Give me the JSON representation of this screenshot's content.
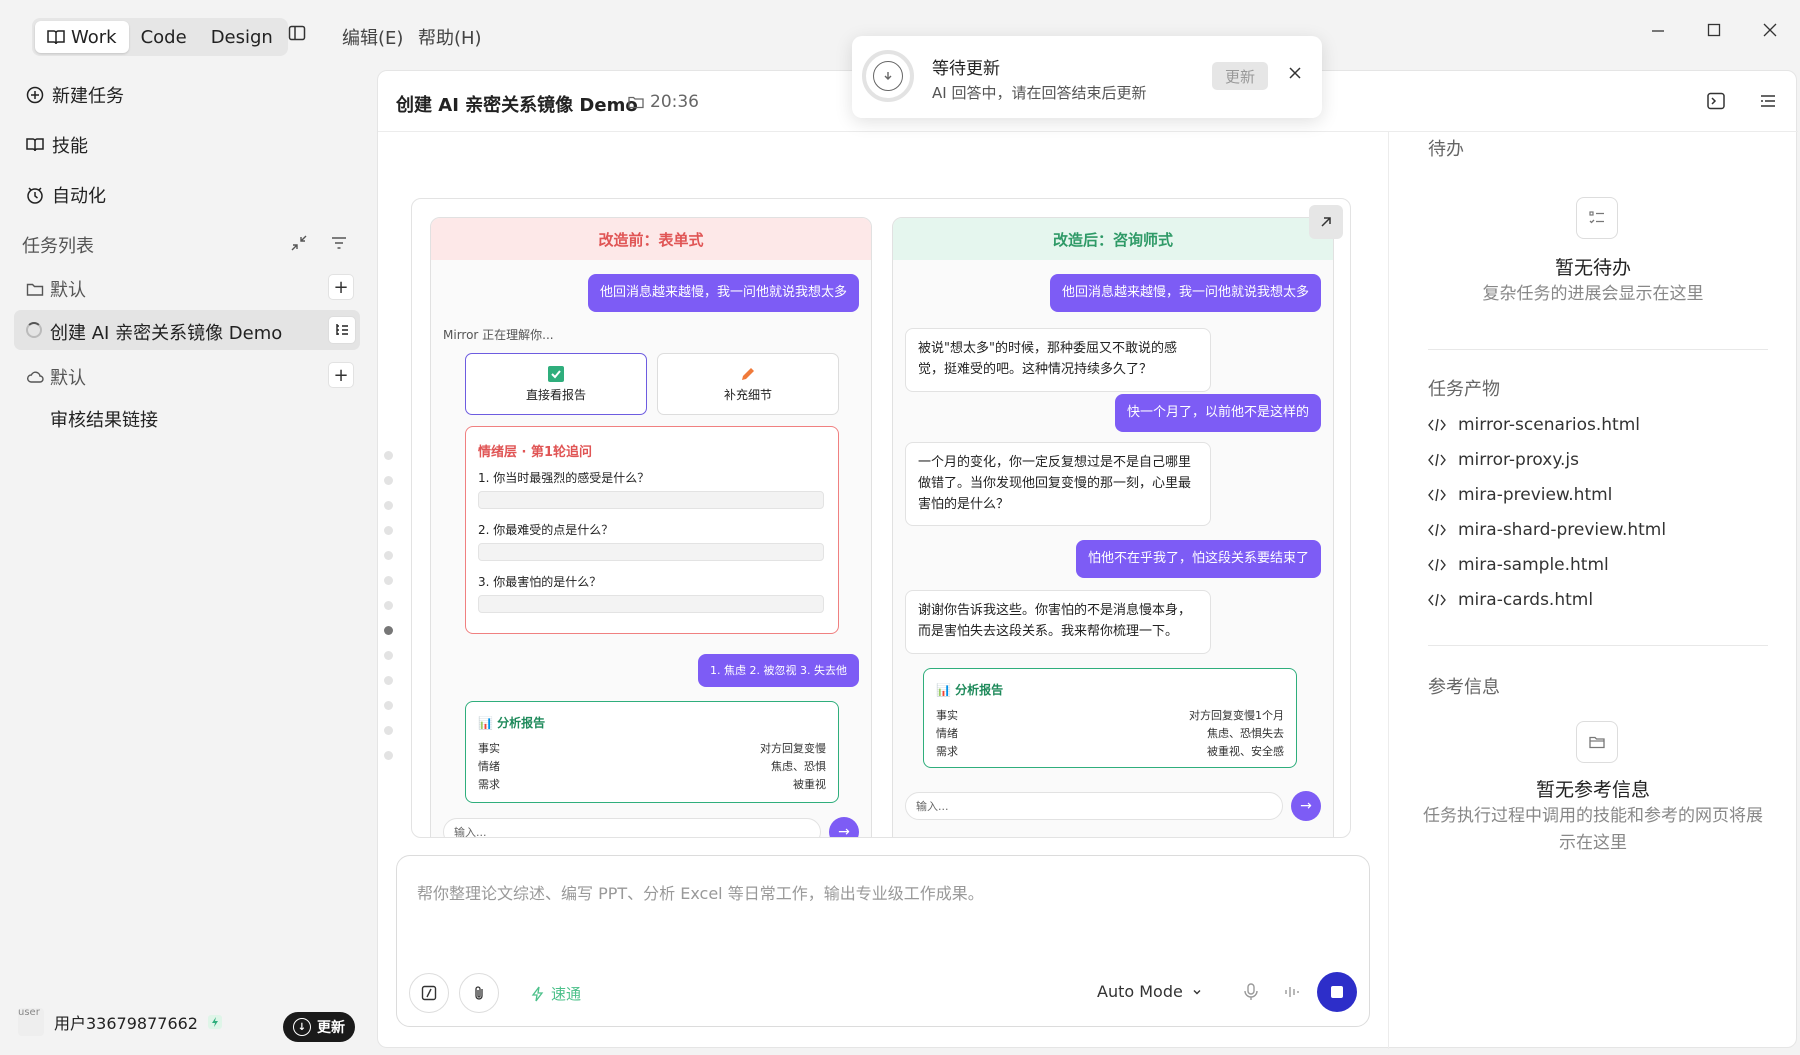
{
  "topbar": {
    "modes": [
      "Work",
      "Code",
      "Design"
    ],
    "menu": [
      "编辑(E)",
      "帮助(H)"
    ]
  },
  "toast": {
    "title": "等待更新",
    "message": "AI 回答中，请在回答结束后更新",
    "button": "更新"
  },
  "sidebar": {
    "nav": [
      "新建任务",
      "技能",
      "自动化"
    ],
    "task_list_title": "任务列表",
    "group1": "默认",
    "active_task": "创建 AI 亲密关系镜像 Demo",
    "group2": "默认",
    "plain_item": "审核结果链接",
    "user_name": "用户33679877662",
    "avatar_alt": "user",
    "update_label": "更新"
  },
  "main": {
    "title": "创建 AI 亲密关系镜像 Demo",
    "time": "20:36"
  },
  "preview": {
    "before": {
      "header": "改造前：表单式",
      "user_msg": "他回消息越来越慢，我一问他就说我想太多",
      "thinking": "Mirror 正在理解你...",
      "opt1": "直接看报告",
      "opt2": "补充细节",
      "card_title": "情绪层 · 第1轮追问",
      "q1": "1. 你当时最强烈的感受是什么？",
      "q2": "2. 你最难受的点是什么？",
      "q3": "3. 你最害怕的是什么？",
      "answer": "1. 焦虑 2. 被忽视 3. 失去他",
      "report_title": "分析报告",
      "report_rows": [
        {
          "k": "事实",
          "v": "对方回复变慢"
        },
        {
          "k": "情绪",
          "v": "焦虑、恐惧"
        },
        {
          "k": "需求",
          "v": "被重视"
        }
      ],
      "input_placeholder": "输入..."
    },
    "after": {
      "header": "改造后：咨询师式",
      "user1": "他回消息越来越慢，我一问他就说我想太多",
      "ai1": "被说\"想太多\"的时候，那种委屈又不敢说的感觉，挺难受的吧。这种情况持续多久了？",
      "user2": "快一个月了，以前他不是这样的",
      "ai2": "一个月的变化，你一定反复想过是不是自己哪里做错了。当你发现他回复变慢的那一刻，心里最害怕的是什么？",
      "user3": "怕他不在乎我了，怕这段关系要结束了",
      "ai3": "谢谢你告诉我这些。你害怕的不是消息慢本身，而是害怕失去这段关系。我来帮你梳理一下。",
      "report_title": "分析报告",
      "report_rows": [
        {
          "k": "事实",
          "v": "对方回复变慢1个月"
        },
        {
          "k": "情绪",
          "v": "焦虑、恐惧失去"
        },
        {
          "k": "需求",
          "v": "被重视、安全感"
        }
      ],
      "input_placeholder": "输入..."
    }
  },
  "composer": {
    "placeholder": "帮你整理论文综述、编写 PPT、分析 Excel 等日常工作，输出专业级工作成果。",
    "speed_label": "速通",
    "mode": "Auto Mode"
  },
  "right": {
    "todo_title": "待办",
    "todo_empty": "暂无待办",
    "todo_desc": "复杂任务的进展会显示在这里",
    "artifacts_title": "任务产物",
    "artifacts": [
      "mirror-scenarios.html",
      "mirror-proxy.js",
      "mira-preview.html",
      "mira-shard-preview.html",
      "mira-sample.html",
      "mira-cards.html"
    ],
    "refs_title": "参考信息",
    "refs_empty": "暂无参考信息",
    "refs_desc": "任务执行过程中调用的技能和参考的网页将展示在这里"
  },
  "colors": {
    "accent_purple": "#7d5cf5",
    "stop_button": "#2d2ec9",
    "before_red": "#e05555",
    "after_green": "#2f9a67",
    "speed_green": "#4cc08a"
  }
}
